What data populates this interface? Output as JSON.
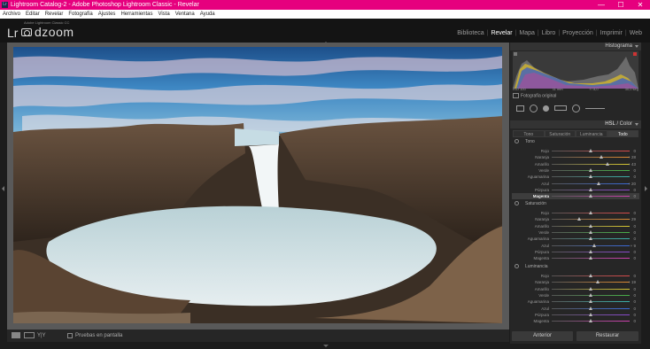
{
  "window": {
    "app_icon": "Lr",
    "title": "Lightroom Catalog-2 - Adobe Photoshop Lightroom Classic - Revelar",
    "controls": [
      "—",
      "☐",
      "✕"
    ]
  },
  "menu": [
    "Archivo",
    "Editar",
    "Revelar",
    "Fotografía",
    "Ajustes",
    "Herramientas",
    "Vista",
    "Ventana",
    "Ayuda"
  ],
  "identity": {
    "prefix": "Lr",
    "name": "dzoom",
    "subtitle": "Adobe Lightroom Classic CC"
  },
  "modules": [
    {
      "label": "Biblioteca",
      "active": false
    },
    {
      "label": "Revelar",
      "active": true
    },
    {
      "label": "Mapa",
      "active": false
    },
    {
      "label": "Libro",
      "active": false
    },
    {
      "label": "Proyección",
      "active": false
    },
    {
      "label": "Imprimir",
      "active": false
    },
    {
      "label": "Web",
      "active": false
    }
  ],
  "histogram": {
    "title": "Histograma",
    "iso": "ISO 100",
    "focal": "11 mm",
    "aperture": "f / 8,0",
    "shutter": "30,0 seg",
    "original_photo": "Fotografía original"
  },
  "hsl": {
    "title": "HSL",
    "slash": "/",
    "color": "Color",
    "tabs": [
      {
        "label": "Tono",
        "active": false
      },
      {
        "label": "Saturación",
        "active": false
      },
      {
        "label": "Luminancia",
        "active": false
      },
      {
        "label": "Todo",
        "active": true
      }
    ],
    "sections": [
      {
        "title": "Tono",
        "rows": [
          {
            "label": "Rojo",
            "value": "0",
            "fraction": 0.5,
            "color": "#d94a4a",
            "highlight": false
          },
          {
            "label": "Naranja",
            "value": "+ 28",
            "fraction": 0.64,
            "color": "#e08a30",
            "highlight": false
          },
          {
            "label": "Amarillo",
            "value": "+ 43",
            "fraction": 0.715,
            "color": "#d8c830",
            "highlight": false
          },
          {
            "label": "Verde",
            "value": "0",
            "fraction": 0.5,
            "color": "#48b048",
            "highlight": false
          },
          {
            "label": "Aguamarina",
            "value": "0",
            "fraction": 0.5,
            "color": "#3ab0a8",
            "highlight": false
          },
          {
            "label": "Azul",
            "value": "+ 20",
            "fraction": 0.6,
            "color": "#3a6ad8",
            "highlight": false
          },
          {
            "label": "Púrpura",
            "value": "0",
            "fraction": 0.5,
            "color": "#8a4ad0",
            "highlight": false
          },
          {
            "label": "Magenta",
            "value": "0",
            "fraction": 0.5,
            "color": "#d040b0",
            "highlight": true
          }
        ]
      },
      {
        "title": "Saturación",
        "rows": [
          {
            "label": "Rojo",
            "value": "0",
            "fraction": 0.5,
            "color": "#d94a4a",
            "highlight": false
          },
          {
            "label": "Naranja",
            "value": "- 29",
            "fraction": 0.355,
            "color": "#e08a30",
            "highlight": false
          },
          {
            "label": "Amarillo",
            "value": "0",
            "fraction": 0.5,
            "color": "#d8c830",
            "highlight": false
          },
          {
            "label": "Verde",
            "value": "0",
            "fraction": 0.5,
            "color": "#48b048",
            "highlight": false
          },
          {
            "label": "Aguamarina",
            "value": "0",
            "fraction": 0.5,
            "color": "#3ab0a8",
            "highlight": false
          },
          {
            "label": "Azul",
            "value": "+ 9",
            "fraction": 0.545,
            "color": "#3a6ad8",
            "highlight": false
          },
          {
            "label": "Púrpura",
            "value": "0",
            "fraction": 0.5,
            "color": "#8a4ad0",
            "highlight": false
          },
          {
            "label": "Magenta",
            "value": "0",
            "fraction": 0.5,
            "color": "#d040b0",
            "highlight": false
          }
        ]
      },
      {
        "title": "Luminancia",
        "rows": [
          {
            "label": "Rojo",
            "value": "0",
            "fraction": 0.5,
            "color": "#d94a4a",
            "highlight": false
          },
          {
            "label": "Naranja",
            "value": "+ 19",
            "fraction": 0.595,
            "color": "#e08a30",
            "highlight": false
          },
          {
            "label": "Amarillo",
            "value": "0",
            "fraction": 0.5,
            "color": "#d8c830",
            "highlight": false
          },
          {
            "label": "Verde",
            "value": "0",
            "fraction": 0.5,
            "color": "#48b048",
            "highlight": false
          },
          {
            "label": "Aguamarina",
            "value": "0",
            "fraction": 0.5,
            "color": "#3ab0a8",
            "highlight": false
          },
          {
            "label": "Azul",
            "value": "0",
            "fraction": 0.5,
            "color": "#3a6ad8",
            "highlight": false
          },
          {
            "label": "Púrpura",
            "value": "0",
            "fraction": 0.5,
            "color": "#8a4ad0",
            "highlight": false
          },
          {
            "label": "Magenta",
            "value": "0",
            "fraction": 0.5,
            "color": "#d040b0",
            "highlight": false
          }
        ]
      }
    ]
  },
  "toolbar": {
    "proof_label": "Pruebas en pantalla",
    "view_before_after": "Y|Y"
  },
  "buttons": {
    "previous": "Anterior",
    "reset": "Restaurar"
  }
}
